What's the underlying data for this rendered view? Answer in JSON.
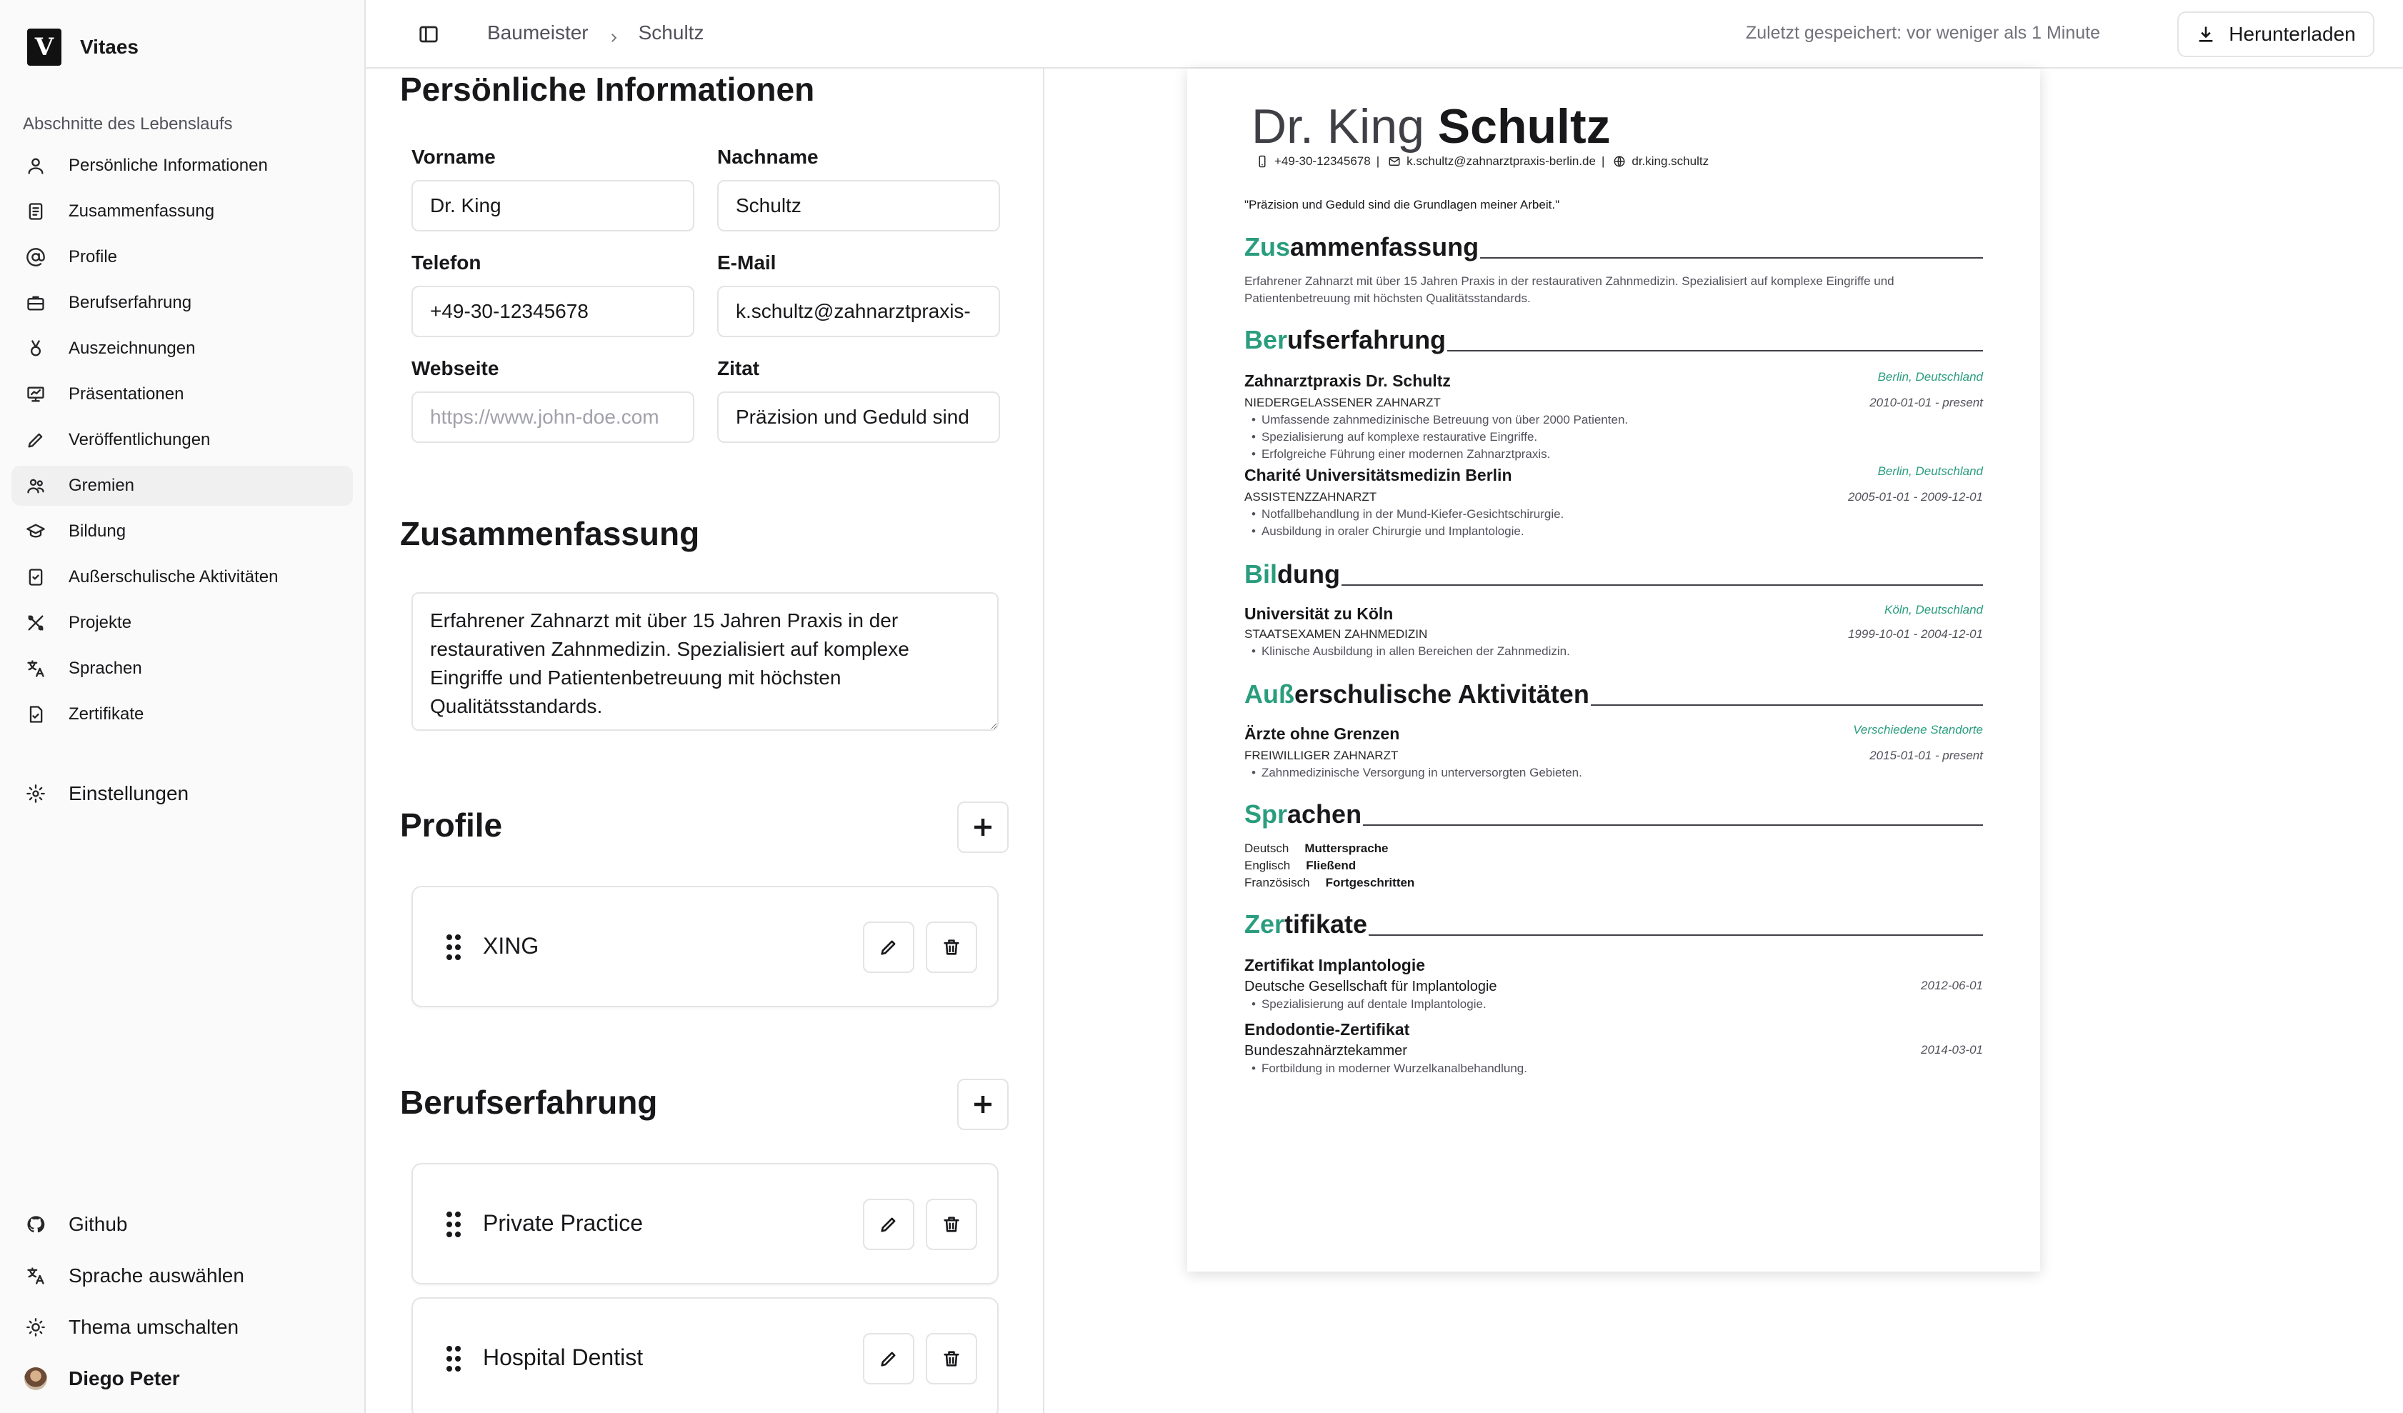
{
  "app": {
    "name": "Vitaes"
  },
  "sidebar": {
    "section_label": "Abschnitte des Lebenslaufs",
    "items": [
      {
        "label": "Persönliche Informationen",
        "icon": "user-icon"
      },
      {
        "label": "Zusammenfassung",
        "icon": "document-icon"
      },
      {
        "label": "Profile",
        "icon": "at-sign-icon"
      },
      {
        "label": "Berufserfahrung",
        "icon": "briefcase-icon"
      },
      {
        "label": "Auszeichnungen",
        "icon": "award-icon"
      },
      {
        "label": "Präsentationen",
        "icon": "presentation-icon"
      },
      {
        "label": "Veröffentlichungen",
        "icon": "pencil-icon"
      },
      {
        "label": "Gremien",
        "icon": "users-icon"
      },
      {
        "label": "Bildung",
        "icon": "graduation-cap-icon"
      },
      {
        "label": "Außerschulische Aktivitäten",
        "icon": "notebook-icon"
      },
      {
        "label": "Projekte",
        "icon": "tools-icon"
      },
      {
        "label": "Sprachen",
        "icon": "languages-icon"
      },
      {
        "label": "Zertifikate",
        "icon": "certificate-icon"
      }
    ],
    "active_index": 7,
    "settings_label": "Einstellungen",
    "footer": {
      "github": "Github",
      "language": "Sprache auswählen",
      "theme": "Thema umschalten",
      "user": "Diego Peter"
    }
  },
  "topbar": {
    "breadcrumb": [
      "Baumeister",
      "Schultz"
    ],
    "saved_status": "Zuletzt gespeichert: vor weniger als 1 Minute",
    "download_label": "Herunterladen"
  },
  "editor": {
    "personal": {
      "title": "Persönliche Informationen",
      "first_name_label": "Vorname",
      "first_name": "Dr. King",
      "last_name_label": "Nachname",
      "last_name": "Schultz",
      "phone_label": "Telefon",
      "phone": "+49-30-12345678",
      "email_label": "E-Mail",
      "email": "k.schultz@zahnarztpraxis-",
      "website_label": "Webseite",
      "website_placeholder": "https://www.john-doe.com",
      "quote_label": "Zitat",
      "quote": "Präzision und Geduld sind"
    },
    "summary": {
      "title": "Zusammenfassung",
      "text": "Erfahrener Zahnarzt mit über 15 Jahren Praxis in der restaurativen Zahnmedizin. Spezialisiert auf komplexe Eingriffe und Patientenbetreuung mit höchsten Qualitätsstandards."
    },
    "profiles": {
      "title": "Profile",
      "items": [
        "XING"
      ]
    },
    "experience": {
      "title": "Berufserfahrung",
      "items": [
        "Private Practice",
        "Hospital Dentist"
      ]
    }
  },
  "resume": {
    "first_name": "Dr. King",
    "last_name": "Schultz",
    "phone": "+49-30-12345678",
    "email": "k.schultz@zahnarztpraxis-berlin.de",
    "website": "dr.king.schultz",
    "quote": "\"Präzision und Geduld sind die Grundlagen meiner Arbeit.\"",
    "accent_color": "#2a9d7e",
    "sections": {
      "summary": {
        "accent": "Zus",
        "rest": "ammenfassung"
      },
      "experience": {
        "accent": "Ber",
        "rest": "ufserfahrung"
      },
      "education": {
        "accent": "Bil",
        "rest": "dung"
      },
      "activities": {
        "accent": "Auß",
        "rest": "erschulische Aktivitäten"
      },
      "languages": {
        "accent": "Spr",
        "rest": "achen"
      },
      "certificates": {
        "accent": "Zer",
        "rest": "tifikate"
      }
    },
    "summary_lines": [
      "Erfahrener Zahnarzt mit über 15 Jahren Praxis in der restaurativen Zahnmedizin. Spezialisiert auf komplexe Eingriffe und",
      "Patientenbetreuung mit höchsten Qualitätsstandards."
    ],
    "experience": [
      {
        "org": "Zahnarztpraxis Dr. Schultz",
        "location": "Berlin, Deutschland",
        "role": "Niedergelassener Zahnarzt",
        "dates": "2010-01-01 - present",
        "bullets": [
          "Umfassende zahnmedizinische Betreuung von über 2000 Patienten.",
          "Spezialisierung auf komplexe restaurative Eingriffe.",
          "Erfolgreiche Führung einer modernen Zahnarztpraxis."
        ]
      },
      {
        "org": "Charité Universitätsmedizin Berlin",
        "location": "Berlin, Deutschland",
        "role": "Assistenzzahnarzt",
        "dates": "2005-01-01 - 2009-12-01",
        "bullets": [
          "Notfallbehandlung in der Mund-Kiefer-Gesichtschirurgie.",
          "Ausbildung in oraler Chirurgie und Implantologie."
        ]
      }
    ],
    "education": [
      {
        "org": "Universität zu Köln",
        "location": "Köln, Deutschland",
        "role": "Staatsexamen Zahnmedizin",
        "dates": "1999-10-01 - 2004-12-01",
        "bullets": [
          "Klinische Ausbildung in allen Bereichen der Zahnmedizin."
        ]
      }
    ],
    "activities": [
      {
        "org": "Ärzte ohne Grenzen",
        "location": "Verschiedene Standorte",
        "role": "Freiwilliger Zahnarzt",
        "dates": "2015-01-01 - present",
        "bullets": [
          "Zahnmedizinische Versorgung in unterversorgten Gebieten."
        ]
      }
    ],
    "languages": [
      {
        "name": "Deutsch",
        "level": "Muttersprache"
      },
      {
        "name": "Englisch",
        "level": "Fließend"
      },
      {
        "name": "Französisch",
        "level": "Fortgeschritten"
      }
    ],
    "certificates": [
      {
        "name": "Zertifikat Implantologie",
        "issuer": "Deutsche Gesellschaft für Implantologie",
        "date": "2012-06-01",
        "bullets": [
          "Spezialisierung auf dentale Implantologie."
        ]
      },
      {
        "name": "Endodontie-Zertifikat",
        "issuer": "Bundeszahnärztekammer",
        "date": "2014-03-01",
        "bullets": [
          "Fortbildung in moderner Wurzelkanalbehandlung."
        ]
      }
    ]
  }
}
